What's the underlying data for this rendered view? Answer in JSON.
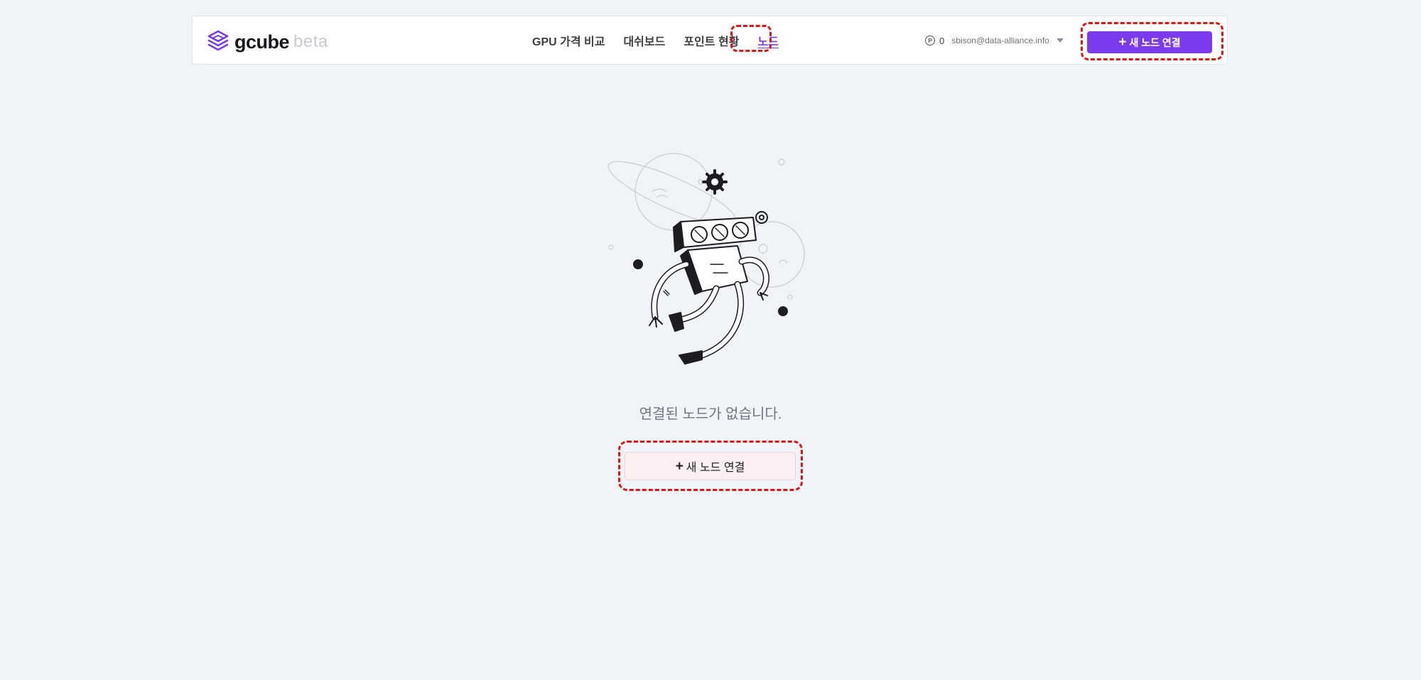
{
  "app": {
    "logo_name": "gcube",
    "logo_tag": "beta"
  },
  "nav": {
    "items": [
      {
        "label": "GPU 가격 비교"
      },
      {
        "label": "대쉬보드"
      },
      {
        "label": "포인트 현황"
      },
      {
        "label": "노드"
      }
    ],
    "active": "노드"
  },
  "account": {
    "points_icon": "P",
    "points": "0",
    "email": "sbison@data-alliance.info"
  },
  "header_action": {
    "plus": "+",
    "label": "새 노드 연결"
  },
  "empty_state": {
    "message": "연결된 노드가 없습니다.",
    "button_plus": "+",
    "button_label": "새 노드 연결"
  },
  "icons": {
    "logo": "stacked-layers-icon",
    "points": "point-coin-icon",
    "dropdown": "caret-down-icon",
    "illustration": "gpu-robot-illustration"
  },
  "colors": {
    "accent": "#7c3aed",
    "background": "#f0f4f9",
    "highlight": "#e11515",
    "empty_button_bg": "#fdeff1"
  }
}
